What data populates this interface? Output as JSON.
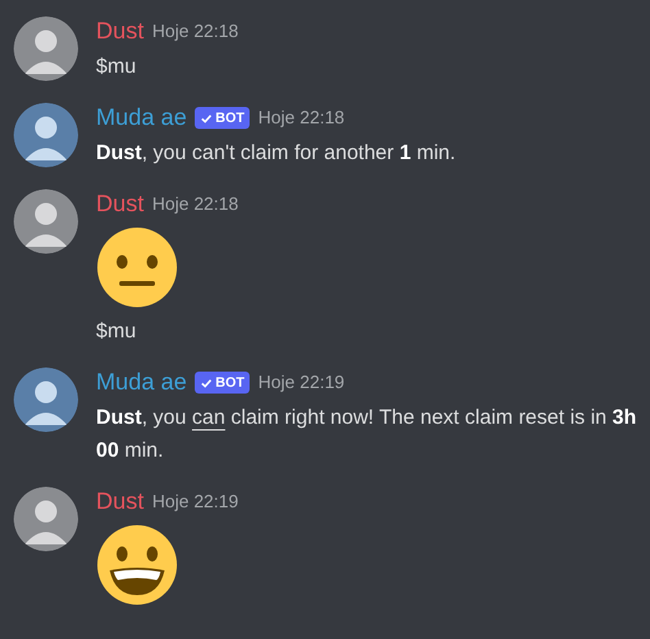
{
  "messages": [
    {
      "author": "Dust",
      "color": "#e5535d",
      "bot": false,
      "time": "Hoje 22:18",
      "content": [
        {
          "kind": "text",
          "parts": [
            {
              "text": "$mu",
              "kind": "plain"
            }
          ]
        }
      ]
    },
    {
      "author": "Muda ae",
      "color": "#3d9fd6",
      "bot": true,
      "badge": "BOT",
      "time": "Hoje 22:18",
      "content": [
        {
          "kind": "text",
          "parts": [
            {
              "text": "Dust",
              "kind": "bold"
            },
            {
              "text": ", you can't claim for another ",
              "kind": "plain"
            },
            {
              "text": "1",
              "kind": "bold"
            },
            {
              "text": " min.",
              "kind": "plain"
            }
          ]
        }
      ]
    },
    {
      "author": "Dust",
      "color": "#e5535d",
      "bot": false,
      "time": "Hoje 22:18",
      "content": [
        {
          "kind": "emoji-neutral"
        },
        {
          "kind": "text",
          "parts": [
            {
              "text": "$mu",
              "kind": "plain"
            }
          ]
        }
      ]
    },
    {
      "author": "Muda ae",
      "color": "#3d9fd6",
      "bot": true,
      "badge": "BOT",
      "time": "Hoje 22:19",
      "content": [
        {
          "kind": "text",
          "parts": [
            {
              "text": "Dust",
              "kind": "bold"
            },
            {
              "text": ", you ",
              "kind": "plain"
            },
            {
              "text": "can",
              "kind": "underline"
            },
            {
              "text": " claim right now! The next claim reset is in ",
              "kind": "plain"
            },
            {
              "text": "3h 00",
              "kind": "bold"
            },
            {
              "text": " min.",
              "kind": "plain"
            }
          ]
        }
      ]
    },
    {
      "author": "Dust",
      "color": "#e5535d",
      "bot": false,
      "time": "Hoje 22:19",
      "content": [
        {
          "kind": "emoji-grin"
        }
      ]
    }
  ]
}
